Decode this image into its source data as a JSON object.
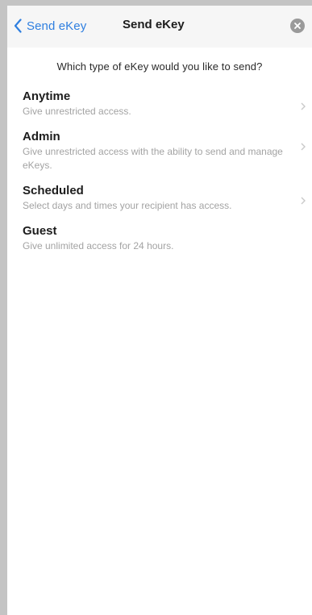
{
  "nav": {
    "back_label": "Send eKey",
    "title": "Send eKey"
  },
  "prompt": "Which type of eKey would you like to send?",
  "options": [
    {
      "title": "Anytime",
      "desc": "Give unrestricted access."
    },
    {
      "title": "Admin",
      "desc": "Give unrestricted access with the ability to send and manage eKeys."
    },
    {
      "title": "Scheduled",
      "desc": "Select days and times your recipient has access."
    },
    {
      "title": "Guest",
      "desc": "Give unlimited access for 24 hours."
    }
  ],
  "colors": {
    "accent": "#2f7fe0",
    "title_text": "#1d1d1d",
    "desc_text": "#a3a3a3",
    "nav_background": "#f6f6f6"
  },
  "icons": {
    "back": "chevron-left-icon",
    "close": "close-circle-icon",
    "row": "chevron-right-icon"
  }
}
